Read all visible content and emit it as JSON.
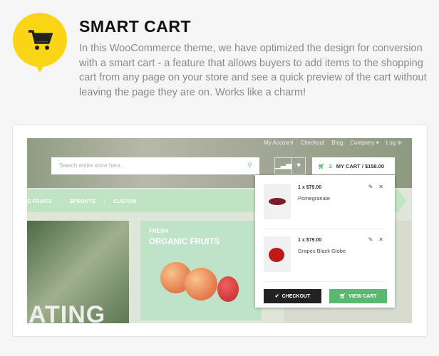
{
  "feature": {
    "title": "SMART CART",
    "icon": "shopping-cart-icon",
    "description": "In this WooCommerce theme, we have optimized the design for conversion with a smart cart - a feature that allows buyers to add items to the shopping cart from any page on your store and see a quick preview of the cart without leaving the page they are on. Works like a charm!"
  },
  "store": {
    "top_links": [
      "My Account",
      "Checkout",
      "Blog",
      "Company ▾",
      "Log In"
    ],
    "search_placeholder": "Search entire store here...",
    "cart": {
      "count": "2",
      "label": "MY CART / $158.00"
    },
    "nav": [
      "C FRUITS",
      "SPROUTS",
      "CUSTOM"
    ],
    "banner_text": "ATING",
    "promo": {
      "tag": "FRESH",
      "title": "ORGANIC FRUITS"
    },
    "cart_items": [
      {
        "qty": "1",
        "price": "x $79.00",
        "name": "Pomegranate"
      },
      {
        "qty": "1",
        "price": "x $79.00",
        "name": "Grapes Black Globe"
      }
    ],
    "checkout_label": "CHECKOUT",
    "view_cart_label": "VIEW CART"
  },
  "colors": {
    "accent_yellow": "#f9d515",
    "green": "#5cb870",
    "dark": "#222"
  }
}
